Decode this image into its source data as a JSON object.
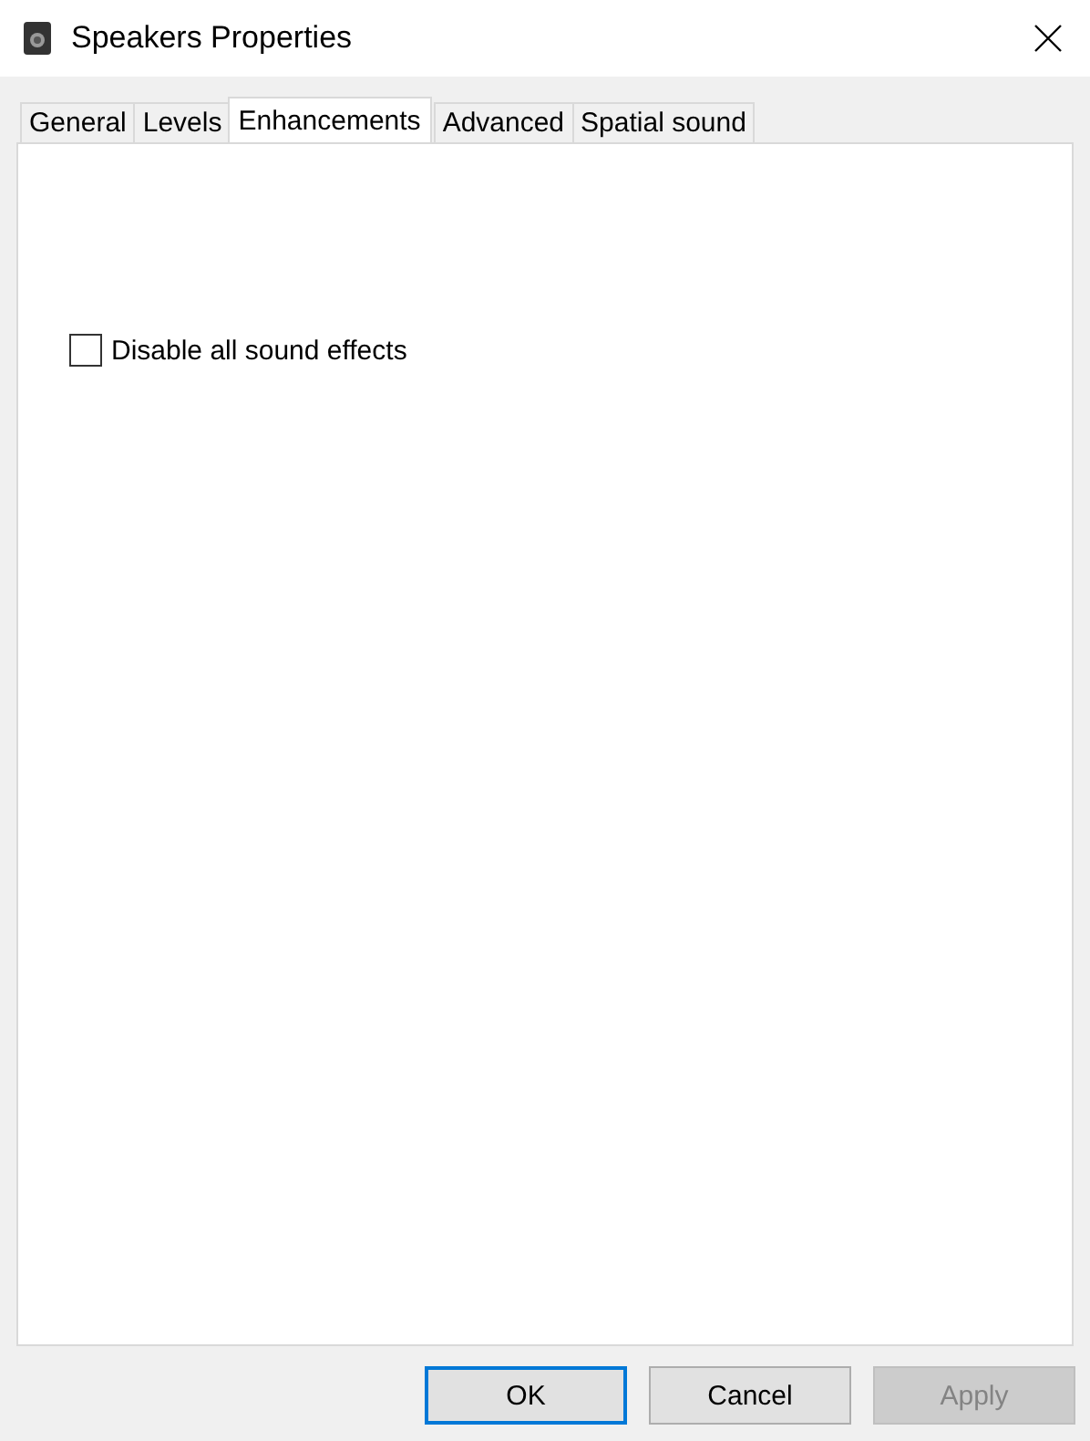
{
  "window": {
    "title": "Speakers Properties"
  },
  "tabs": [
    {
      "label": "General",
      "selected": false
    },
    {
      "label": "Levels",
      "selected": false
    },
    {
      "label": "Enhancements",
      "selected": true
    },
    {
      "label": "Advanced",
      "selected": false
    },
    {
      "label": "Spatial sound",
      "selected": false
    }
  ],
  "options": [
    {
      "label": "Disable all sound effects",
      "checked": false
    }
  ],
  "buttons": [
    {
      "label": "OK",
      "default": true,
      "disabled": false
    },
    {
      "label": "Cancel",
      "default": false,
      "disabled": false
    },
    {
      "label": "Apply",
      "default": false,
      "disabled": true
    }
  ]
}
